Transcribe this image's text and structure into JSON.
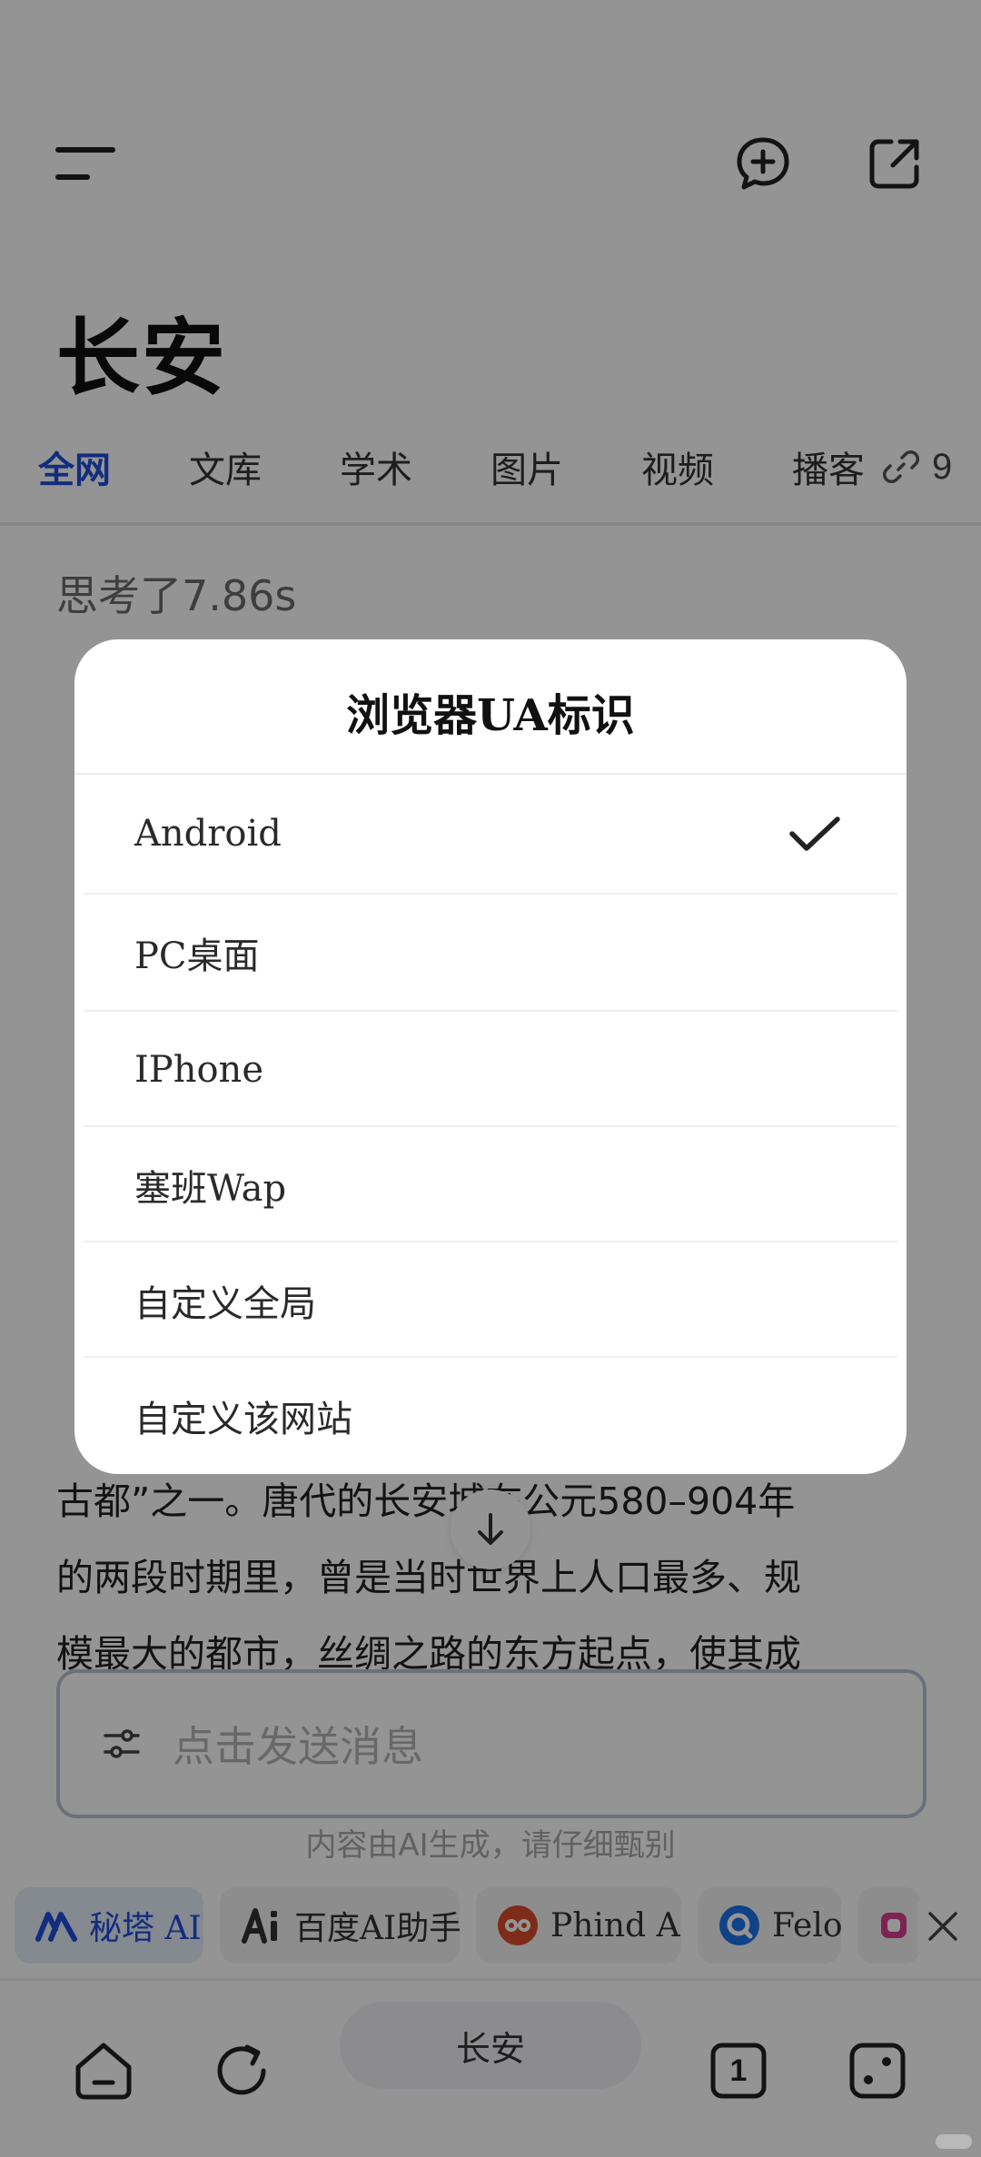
{
  "page": {
    "title": "长安",
    "tabs": [
      "全网",
      "文库",
      "学术",
      "图片",
      "视频",
      "播客"
    ],
    "active_tab": "全网",
    "sources_count": "9",
    "think_time": "思考了7.86s"
  },
  "answer": {
    "lines": [
      "古都”之一。唐代的长安城在公元580–904年",
      "的两段时期里，曾是当时世界上人口最多、规",
      "模最大的都市，丝绸之路的东方起点，使其成"
    ]
  },
  "input": {
    "placeholder": "点击发送消息",
    "ai_note": "内容由AI生成，请仔细甄别"
  },
  "ai_chips": [
    {
      "label": "秘塔 AI",
      "icon": "metaso-logo",
      "active": true
    },
    {
      "label": "百度AI助手",
      "icon": "baidu-ai-logo",
      "active": false
    },
    {
      "label": "Phind AI",
      "icon": "phind-logo",
      "active": false
    },
    {
      "label": "Felo",
      "icon": "felo-logo",
      "active": false
    }
  ],
  "bottom_nav": {
    "address": "长安",
    "tabs_count": "1"
  },
  "dialog": {
    "title": "浏览器UA标识",
    "options": [
      "Android",
      "PC桌面",
      "IPhone",
      "塞班Wap",
      "自定义全局",
      "自定义该网站"
    ],
    "selected": "Android"
  },
  "colors": {
    "accent": "#1f4fd8",
    "overlay": "rgba(0,0,0,0.42)"
  }
}
